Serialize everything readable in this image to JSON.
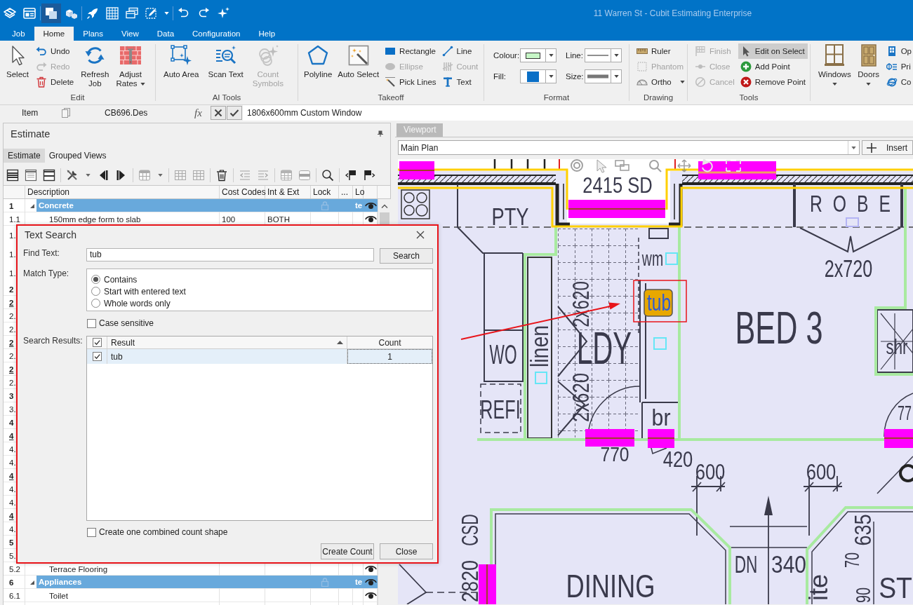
{
  "title_bar": {
    "quick_access": [
      {
        "selected": false
      },
      {
        "selected": false
      },
      {
        "selected": true
      },
      {
        "selected": false
      },
      {
        "selected": false
      },
      {
        "selected": false
      },
      {
        "selected": false
      },
      {
        "selected": false
      },
      {
        "selected": false
      },
      {
        "selected": false
      },
      {
        "selected": false
      }
    ],
    "title": "11 Warren St - Cubit Estimating Enterprise"
  },
  "menu_tabs": [
    {
      "label": "Job",
      "selected": false
    },
    {
      "label": "Home",
      "selected": true
    },
    {
      "label": "Plans",
      "selected": false
    },
    {
      "label": "View",
      "selected": false
    },
    {
      "label": "Data",
      "selected": false
    },
    {
      "label": "Configuration",
      "selected": false
    },
    {
      "label": "Help",
      "selected": false
    }
  ],
  "ribbon": {
    "groups": [
      {
        "label": "Edit",
        "items": [
          {
            "kind": "large",
            "label": "Select",
            "disabled": false
          },
          {
            "kind": "stack",
            "items": [
              {
                "kind": "button",
                "label": "Undo",
                "disabled": false
              },
              {
                "kind": "button",
                "label": "Redo",
                "disabled": true
              },
              {
                "kind": "button",
                "label": "Delete",
                "disabled": false
              }
            ]
          },
          {
            "kind": "large",
            "label": "Refresh\nJob",
            "disabled": false
          },
          {
            "kind": "large",
            "label": "Adjust\nRates",
            "disabled": false,
            "dropdown": true
          }
        ]
      },
      {
        "label": "AI Tools",
        "items": [
          {
            "kind": "large",
            "label": "Auto Area",
            "disabled": false
          },
          {
            "kind": "large",
            "label": "Scan Text",
            "disabled": false
          },
          {
            "kind": "large",
            "label": "Count\nSymbols",
            "disabled": true
          }
        ]
      },
      {
        "label": "Takeoff",
        "items": [
          {
            "kind": "large",
            "label": "Polyline",
            "disabled": false
          },
          {
            "kind": "large",
            "label": "Auto Select",
            "disabled": false
          },
          {
            "kind": "stack",
            "items": [
              {
                "kind": "button",
                "label": "Rectangle",
                "disabled": false
              },
              {
                "kind": "button",
                "label": "Ellipse",
                "disabled": true
              },
              {
                "kind": "button",
                "label": "Pick Lines",
                "disabled": false
              }
            ]
          },
          {
            "kind": "stack",
            "items": [
              {
                "kind": "button",
                "label": "Line",
                "disabled": false
              },
              {
                "kind": "button",
                "label": "Count",
                "disabled": true
              },
              {
                "kind": "button",
                "label": "Text",
                "disabled": false
              }
            ]
          }
        ]
      },
      {
        "label": "Format",
        "items": [
          {
            "kind": "stack",
            "items": [
              {
                "kind": "stroke-swatch",
                "label": "Colour:",
                "color": "#c6f6c6"
              },
              {
                "kind": "fill-swatch",
                "label": "Fill:",
                "color": "#0a6fc6"
              }
            ]
          },
          {
            "kind": "stack",
            "items": [
              {
                "kind": "line-style",
                "label": "Line:"
              },
              {
                "kind": "line-weight",
                "label": "Size:"
              }
            ]
          }
        ]
      },
      {
        "label": "Drawing",
        "items": [
          {
            "kind": "stack",
            "items": [
              {
                "kind": "button",
                "label": "Ruler",
                "disabled": false
              },
              {
                "kind": "button",
                "label": "Phantom",
                "disabled": true
              },
              {
                "kind": "button",
                "label": "Ortho",
                "disabled": false,
                "dropdown": true
              }
            ]
          }
        ]
      },
      {
        "label": "Tools",
        "items": [
          {
            "kind": "stack",
            "items": [
              {
                "kind": "button",
                "label": "Finish",
                "disabled": true,
                "selected": false
              },
              {
                "kind": "button",
                "label": "Close",
                "disabled": true,
                "selected": false
              },
              {
                "kind": "button",
                "label": "Cancel",
                "disabled": true,
                "selected": false
              }
            ]
          },
          {
            "kind": "stack",
            "items": [
              {
                "kind": "button",
                "label": "Edit on Select",
                "disabled": false,
                "selected": true
              },
              {
                "kind": "button",
                "label": "Add Point",
                "disabled": false,
                "selected": false
              },
              {
                "kind": "button",
                "label": "Remove Point",
                "disabled": false,
                "selected": false
              }
            ]
          }
        ]
      },
      {
        "items": [
          {
            "kind": "split",
            "label": "Windows",
            "disabled": false,
            "dropdown": true
          },
          {
            "kind": "split",
            "label": "Doors",
            "disabled": false,
            "dropdown": true
          },
          {
            "kind": "stack",
            "items": [
              {
                "kind": "button",
                "label": "Op",
                "disabled": false
              },
              {
                "kind": "button",
                "label": "Pri",
                "disabled": false
              },
              {
                "kind": "button",
                "label": "Co",
                "disabled": false
              }
            ]
          }
        ]
      }
    ]
  },
  "formula_bar": {
    "label": "Item",
    "cell": "CB696.Des",
    "fx": "fx",
    "value": "1806x600mm Custom Window"
  },
  "estimate": {
    "title": "Estimate",
    "tabs": [
      {
        "label": "Estimate",
        "selected": true
      },
      {
        "label": "Grouped Views",
        "selected": false
      }
    ],
    "toolbar": [
      {
        "disabled": false
      },
      {
        "disabled": false
      },
      {
        "disabled": false
      },
      {
        "disabled": false
      },
      {
        "disabled": false
      },
      {
        "disabled": false
      },
      {
        "disabled": true
      },
      {
        "disabled": true
      },
      {
        "disabled": true
      },
      {
        "disabled": false
      },
      {
        "disabled": true
      },
      {
        "disabled": true
      },
      {
        "disabled": true
      },
      {
        "disabled": true
      },
      {
        "disabled": false
      },
      {
        "disabled": false
      },
      {
        "disabled": false
      }
    ],
    "columns": [
      "Description",
      "Cost Codes",
      "Int & Ext",
      "Lock",
      "...",
      "Lo"
    ],
    "rows": [
      {
        "number": "1",
        "kind": "group",
        "expanded": true,
        "description": "Concrete",
        "lo": "te"
      },
      {
        "number": "1.1",
        "kind": "item",
        "description": "150mm edge form to slab",
        "cost_code": "100",
        "int_ext": "BOTH"
      },
      {
        "number": "1.",
        "kind": "item"
      },
      {
        "number": "1.",
        "kind": "item"
      },
      {
        "number": "1.",
        "kind": "item"
      },
      {
        "number": "2",
        "kind": "group"
      },
      {
        "number": "2",
        "kind": "subgroup"
      },
      {
        "number": "2.",
        "kind": "item"
      },
      {
        "number": "2.",
        "kind": "item"
      },
      {
        "number": "2",
        "kind": "subgroup"
      },
      {
        "number": "2.",
        "kind": "item"
      },
      {
        "number": "2",
        "kind": "subgroup"
      },
      {
        "number": "2.",
        "kind": "item"
      },
      {
        "number": "3",
        "kind": "group"
      },
      {
        "number": "3.",
        "kind": "item"
      },
      {
        "number": "4",
        "kind": "group"
      },
      {
        "number": "4",
        "kind": "subgroup"
      },
      {
        "number": "4.",
        "kind": "item"
      },
      {
        "number": "4.",
        "kind": "item"
      },
      {
        "number": "4",
        "kind": "subgroup"
      },
      {
        "number": "4.",
        "kind": "item"
      },
      {
        "number": "4.",
        "kind": "item"
      },
      {
        "number": "4",
        "kind": "subgroup"
      },
      {
        "number": "4.",
        "kind": "item"
      },
      {
        "number": "5",
        "kind": "group"
      },
      {
        "number": "5.",
        "kind": "item"
      },
      {
        "number": "5.2",
        "kind": "item",
        "description": "Terrace Flooring"
      },
      {
        "number": "6",
        "kind": "group",
        "expanded": true,
        "description": "Appliances",
        "lo": "te"
      },
      {
        "number": "6.1",
        "kind": "item",
        "description": "Toilet"
      }
    ]
  },
  "viewport": {
    "tab": "Viewport",
    "plan": "Main Plan",
    "insert_button": "Insert",
    "plan_labels": [
      {
        "text": "2415 SD",
        "highlighted": false
      },
      {
        "text": "PTY",
        "highlighted": false
      },
      {
        "text": "ROBE",
        "highlighted": false
      },
      {
        "text": "wm",
        "highlighted": false
      },
      {
        "text": "2x720",
        "highlighted": false
      },
      {
        "text": "WO",
        "highlighted": false
      },
      {
        "text": "linen",
        "highlighted": false
      },
      {
        "text": "2x620",
        "highlighted": false
      },
      {
        "text": "tub",
        "highlighted": true
      },
      {
        "text": "LDY",
        "highlighted": false
      },
      {
        "text": "BED 3",
        "highlighted": false
      },
      {
        "text": "shr",
        "highlighted": false
      },
      {
        "text": "REFI",
        "highlighted": false
      },
      {
        "text": "2x620",
        "highlighted": false
      },
      {
        "text": "br",
        "highlighted": false
      },
      {
        "text": "77",
        "highlighted": false
      },
      {
        "text": "770",
        "highlighted": false
      },
      {
        "text": "420",
        "highlighted": false
      },
      {
        "text": "600",
        "highlighted": false
      },
      {
        "text": "600",
        "highlighted": false
      },
      {
        "text": "CSD",
        "highlighted": false
      },
      {
        "text": "635",
        "highlighted": false
      },
      {
        "text": "2820",
        "highlighted": false
      },
      {
        "text": "DN",
        "highlighted": false
      },
      {
        "text": "340",
        "highlighted": false
      },
      {
        "text": "70",
        "highlighted": false
      },
      {
        "text": "DINING",
        "highlighted": false
      },
      {
        "text": "ite",
        "highlighted": false
      },
      {
        "text": "90",
        "highlighted": false
      },
      {
        "text": "ST",
        "highlighted": false
      }
    ]
  },
  "text_search": {
    "title": "Text Search",
    "find_label": "Find Text:",
    "find_value": "tub",
    "search_button": "Search",
    "match_label": "Match Type:",
    "match_options": [
      {
        "label": "Contains",
        "selected": true
      },
      {
        "label": "Start with entered text",
        "selected": false
      },
      {
        "label": "Whole words only",
        "selected": false
      }
    ],
    "case_sensitive": {
      "label": "Case sensitive",
      "checked": false
    },
    "results_label": "Search Results:",
    "results": {
      "header_checked": true,
      "columns": [
        "Result",
        "Count"
      ],
      "sort_ascending": true,
      "rows": [
        {
          "checked": true,
          "selected": true,
          "result": "tub",
          "count": "1"
        }
      ]
    },
    "combine_shape": {
      "label": "Create one combined count shape",
      "checked": false
    },
    "buttons": [
      "Create Count",
      "Close"
    ]
  }
}
